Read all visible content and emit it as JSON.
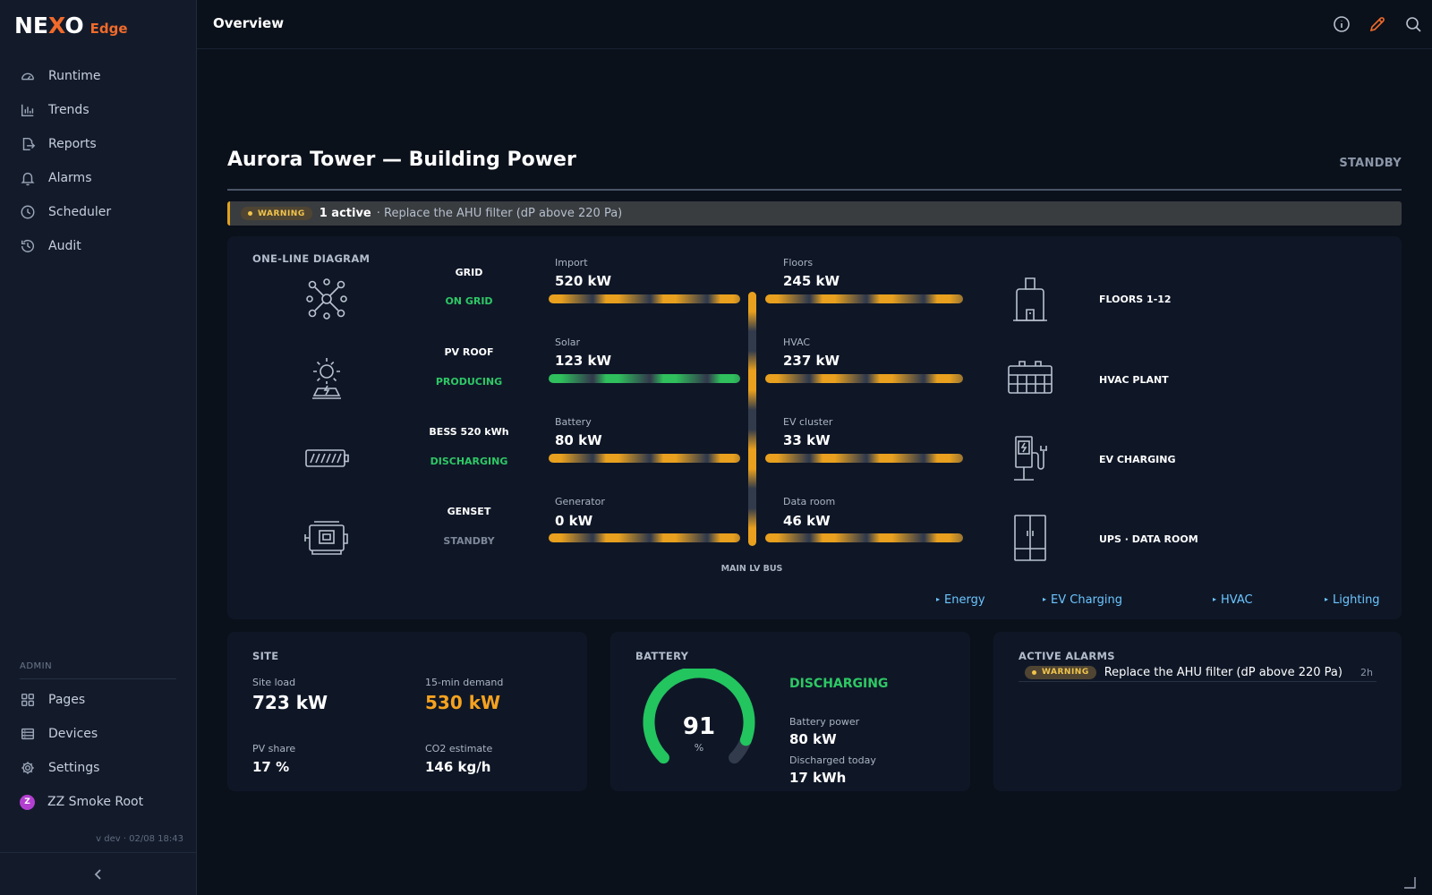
{
  "logo": {
    "main_a": "NE",
    "main_x": "X",
    "main_b": "O",
    "sub": "Edge"
  },
  "nav": {
    "items": [
      {
        "label": "Runtime",
        "icon": "gauge-icon"
      },
      {
        "label": "Trends",
        "icon": "bar-chart-icon"
      },
      {
        "label": "Reports",
        "icon": "report-export-icon"
      },
      {
        "label": "Alarms",
        "icon": "bell-icon"
      },
      {
        "label": "Scheduler",
        "icon": "clock-icon"
      },
      {
        "label": "Audit",
        "icon": "history-icon"
      }
    ],
    "admin_label": "ADMIN",
    "admin_items": [
      {
        "label": "Pages",
        "icon": "grid-icon"
      },
      {
        "label": "Devices",
        "icon": "devices-icon"
      },
      {
        "label": "Settings",
        "icon": "gear-icon"
      }
    ],
    "user": {
      "initial": "Z",
      "name": "ZZ Smoke Root"
    },
    "version": "v dev · 02/08 18:43"
  },
  "topbar": {
    "title": "Overview"
  },
  "page": {
    "title": "Aurora Tower — Building Power",
    "state": "STANDBY"
  },
  "banner": {
    "level": "WARNING",
    "count": "1 active",
    "message": "· Replace the AHU filter (dP above 220 Pa)"
  },
  "diagram": {
    "title": "ONE-LINE DIAGRAM",
    "sources": [
      {
        "name": "GRID",
        "status": "ON GRID",
        "status_color": "#2ec865",
        "icon": "grid-network-icon"
      },
      {
        "name": "PV ROOF",
        "status": "PRODUCING",
        "status_color": "#2ec865",
        "icon": "solar-panel-icon"
      },
      {
        "name": "BESS 520 kWh",
        "status": "DISCHARGING",
        "status_color": "#2ec865",
        "icon": "battery-icon"
      },
      {
        "name": "GENSET",
        "status": "STANDBY",
        "status_color": "#7c8798",
        "icon": "generator-icon"
      }
    ],
    "source_meters": [
      {
        "label": "Import",
        "value": "520 kW"
      },
      {
        "label": "Solar",
        "value": "123 kW"
      },
      {
        "label": "Battery",
        "value": "80 kW"
      },
      {
        "label": "Generator",
        "value": "0 kW"
      }
    ],
    "load_meters": [
      {
        "label": "Floors",
        "value": "245 kW"
      },
      {
        "label": "HVAC",
        "value": "237 kW"
      },
      {
        "label": "EV cluster",
        "value": "33 kW"
      },
      {
        "label": "Data room",
        "value": "46 kW"
      }
    ],
    "bus_label": "MAIN LV BUS",
    "loads": [
      {
        "name": "FLOORS 1-12",
        "icon": "building-icon"
      },
      {
        "name": "HVAC PLANT",
        "icon": "hvac-unit-icon"
      },
      {
        "name": "EV CHARGING",
        "icon": "ev-charger-icon"
      },
      {
        "name": "UPS · DATA ROOM",
        "icon": "server-cabinet-icon"
      }
    ],
    "links": [
      "Energy",
      "EV Charging",
      "HVAC",
      "Lighting"
    ]
  },
  "site": {
    "title": "SITE",
    "site_load_label": "Site load",
    "site_load": "723 kW",
    "demand_label": "15-min demand",
    "demand": "530 kW",
    "pv_share_label": "PV share",
    "pv_share": "17 %",
    "co2_label": "CO2 estimate",
    "co2": "146 kg/h"
  },
  "battery": {
    "title": "BATTERY",
    "soc": 91,
    "soc_text": "91",
    "soc_unit": "%",
    "status": "DISCHARGING",
    "power_label": "Battery power",
    "power": "80 kW",
    "discharged_label": "Discharged today",
    "discharged": "17 kWh",
    "gauge_color": "#22c55e"
  },
  "alarms": {
    "title": "ACTIVE ALARMS",
    "items": [
      {
        "level": "WARNING",
        "message": "Replace the AHU filter (dP above 220 Pa)",
        "age": "2h"
      }
    ]
  },
  "colors": {
    "accent": "#f06a2a",
    "warning": "#f2c44c",
    "ok": "#2ec865",
    "link": "#6cc6ff",
    "flow": "#e8a01e"
  }
}
